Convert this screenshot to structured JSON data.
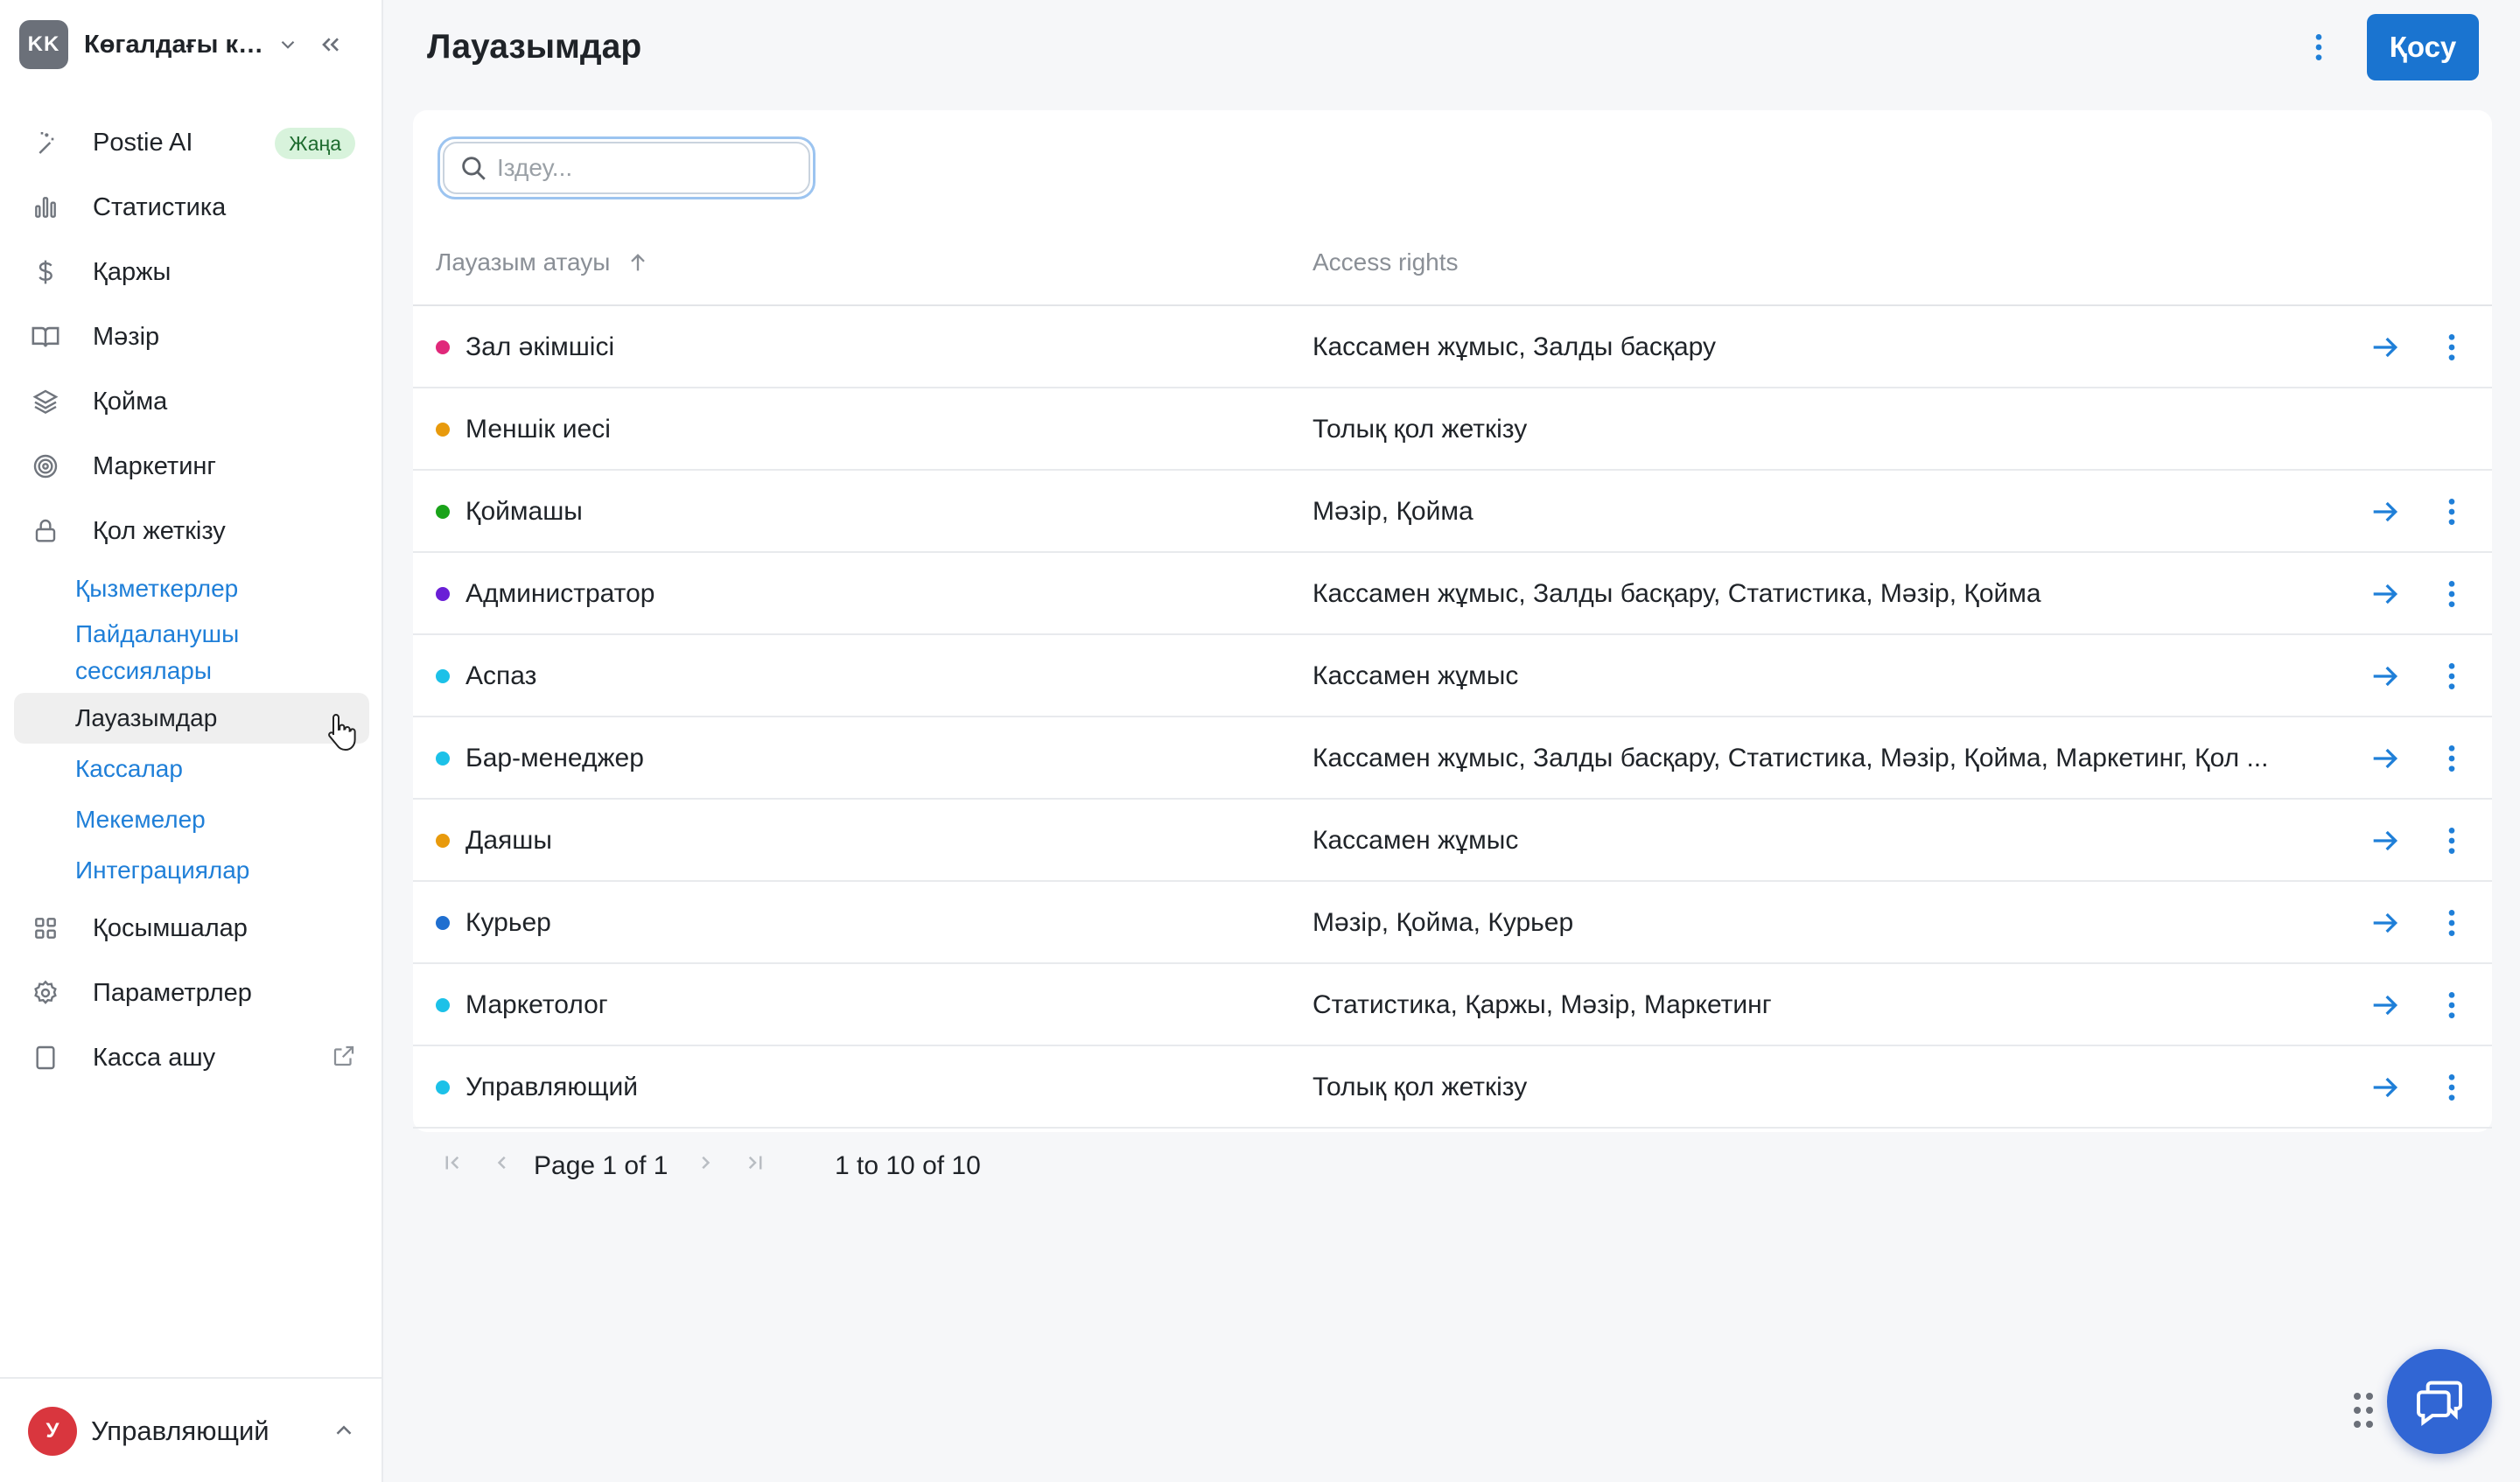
{
  "account": {
    "initials": "KK",
    "name": "Көгалдағы ка..."
  },
  "sidebar": {
    "items": [
      {
        "label": "Postie AI",
        "icon": "ai-wand-icon",
        "badge": "Жаңа"
      },
      {
        "label": "Статистика",
        "icon": "bar-chart-icon"
      },
      {
        "label": "Қаржы",
        "icon": "dollar-icon"
      },
      {
        "label": "Мәзір",
        "icon": "book-icon"
      },
      {
        "label": "Қойма",
        "icon": "layers-icon"
      },
      {
        "label": "Маркетинг",
        "icon": "target-icon"
      },
      {
        "label": "Қол жеткізу",
        "icon": "lock-icon"
      }
    ],
    "sub_items": [
      {
        "label": "Қызметкерлер"
      },
      {
        "label": "Пайдаланушы сессиялары"
      },
      {
        "label": "Лауазымдар",
        "active": true
      },
      {
        "label": "Кассалар"
      },
      {
        "label": "Мекемелер"
      },
      {
        "label": "Интеграциялар"
      }
    ],
    "bottom_items": [
      {
        "label": "Қосымшалар",
        "icon": "grid-icon"
      },
      {
        "label": "Параметрлер",
        "icon": "gear-icon"
      },
      {
        "label": "Касса ашу",
        "icon": "tablet-icon"
      }
    ]
  },
  "user": {
    "initial": "У",
    "name": "Управляющий"
  },
  "header": {
    "title": "Лауазымдар",
    "add_label": "Қосу"
  },
  "search": {
    "placeholder": "Іздеу..."
  },
  "table": {
    "columns": [
      "Лауазым атауы",
      "Access rights"
    ],
    "rows": [
      {
        "name": "Зал әкімшісі",
        "rights": "Кассамен жұмыс, Залды басқару",
        "color": "#e0287a",
        "actions": true
      },
      {
        "name": "Меншік иесі",
        "rights": "Толық қол жеткізу",
        "color": "#e89a0c",
        "actions": false
      },
      {
        "name": "Қоймашы",
        "rights": "Мәзір, Қойма",
        "color": "#1aa31a",
        "actions": true
      },
      {
        "name": "Администратор",
        "rights": "Кассамен жұмыс, Залды басқару, Статистика, Мәзір, Қойма",
        "color": "#6a1fd6",
        "actions": true
      },
      {
        "name": "Аспаз",
        "rights": "Кассамен жұмыс",
        "color": "#1cc1e8",
        "actions": true
      },
      {
        "name": "Бар-менеджер",
        "rights": "Кассамен жұмыс, Залды басқару, Статистика, Мәзір, Қойма, Маркетинг, Қол ...",
        "color": "#1cc1e8",
        "actions": true
      },
      {
        "name": "Даяшы",
        "rights": "Кассамен жұмыс",
        "color": "#e89a0c",
        "actions": true
      },
      {
        "name": "Курьер",
        "rights": "Мәзір, Қойма, Курьер",
        "color": "#1f6fd0",
        "actions": true
      },
      {
        "name": "Маркетолог",
        "rights": "Статистика, Қаржы, Мәзір, Маркетинг",
        "color": "#1cc1e8",
        "actions": true
      },
      {
        "name": "Управляющий",
        "rights": "Толық қол жеткізу",
        "color": "#1cc1e8",
        "actions": true
      }
    ]
  },
  "pagination": {
    "page_text": "Page 1 of 1",
    "range_text": "1 to 10 of 10"
  },
  "colors": {
    "accent": "#1a74d0",
    "link": "#1f7fd8",
    "badge_bg": "#d8f3dc"
  }
}
